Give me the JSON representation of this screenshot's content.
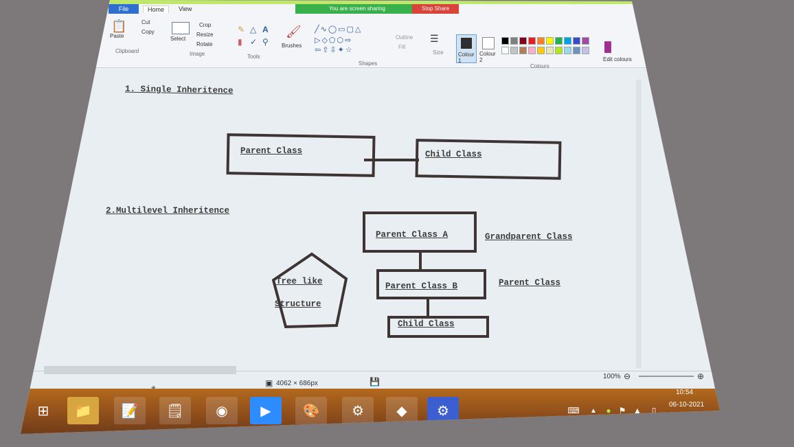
{
  "ribbon": {
    "tabs": {
      "file": "File",
      "home": "Home",
      "view": "View"
    },
    "sharing_banner": "You are screen sharing",
    "stop_share": "Stop Share",
    "clipboard": {
      "paste": "Paste",
      "cut": "Cut",
      "copy": "Copy",
      "label": "Clipboard"
    },
    "image": {
      "select": "Select",
      "crop": "Crop",
      "resize": "Resize",
      "rotate": "Rotate",
      "label": "Image"
    },
    "tools": {
      "label": "Tools"
    },
    "brushes": "Brushes",
    "shapes": {
      "outline": "Outline",
      "fill": "Fill",
      "label": "Shapes"
    },
    "size": "Size",
    "colour1": "Colour 1",
    "colour2": "Colour 2",
    "colours_label": "Colours",
    "edit_colours": "Edit colours",
    "palette": [
      "#000000",
      "#7f7f7f",
      "#880015",
      "#ed1c24",
      "#ff7f27",
      "#fff200",
      "#22b14c",
      "#00a2e8",
      "#3f48cc",
      "#a349a4",
      "#ffffff",
      "#c3c3c3",
      "#b97a57",
      "#ffaec9",
      "#ffc90e",
      "#efe4b0",
      "#b5e61d",
      "#99d9ea",
      "#7092be",
      "#c8bfe7"
    ]
  },
  "canvas": {
    "heading1": "1. Single Inheritence",
    "single_parent": "Parent Class",
    "single_child": "Child Class",
    "heading2": "2.Multilevel Inheritence",
    "parent_a": "Parent Class A",
    "grandparent_label": "Grandparent Class",
    "parent_b": "Parent Class B",
    "parent_label": "Parent Class",
    "child": "Child Class",
    "tree_line1": "Tree like",
    "tree_line2": "Structure"
  },
  "status": {
    "dimensions": "4062 × 686px",
    "zoom": "100%"
  },
  "taskbar": {
    "apps": [
      "windows-start",
      "file-explorer",
      "notes",
      "sticky-notes",
      "chrome",
      "zoom",
      "paint",
      "system-monitor",
      "store",
      "settings"
    ],
    "time": "10:54",
    "date": "06-10-2021"
  }
}
